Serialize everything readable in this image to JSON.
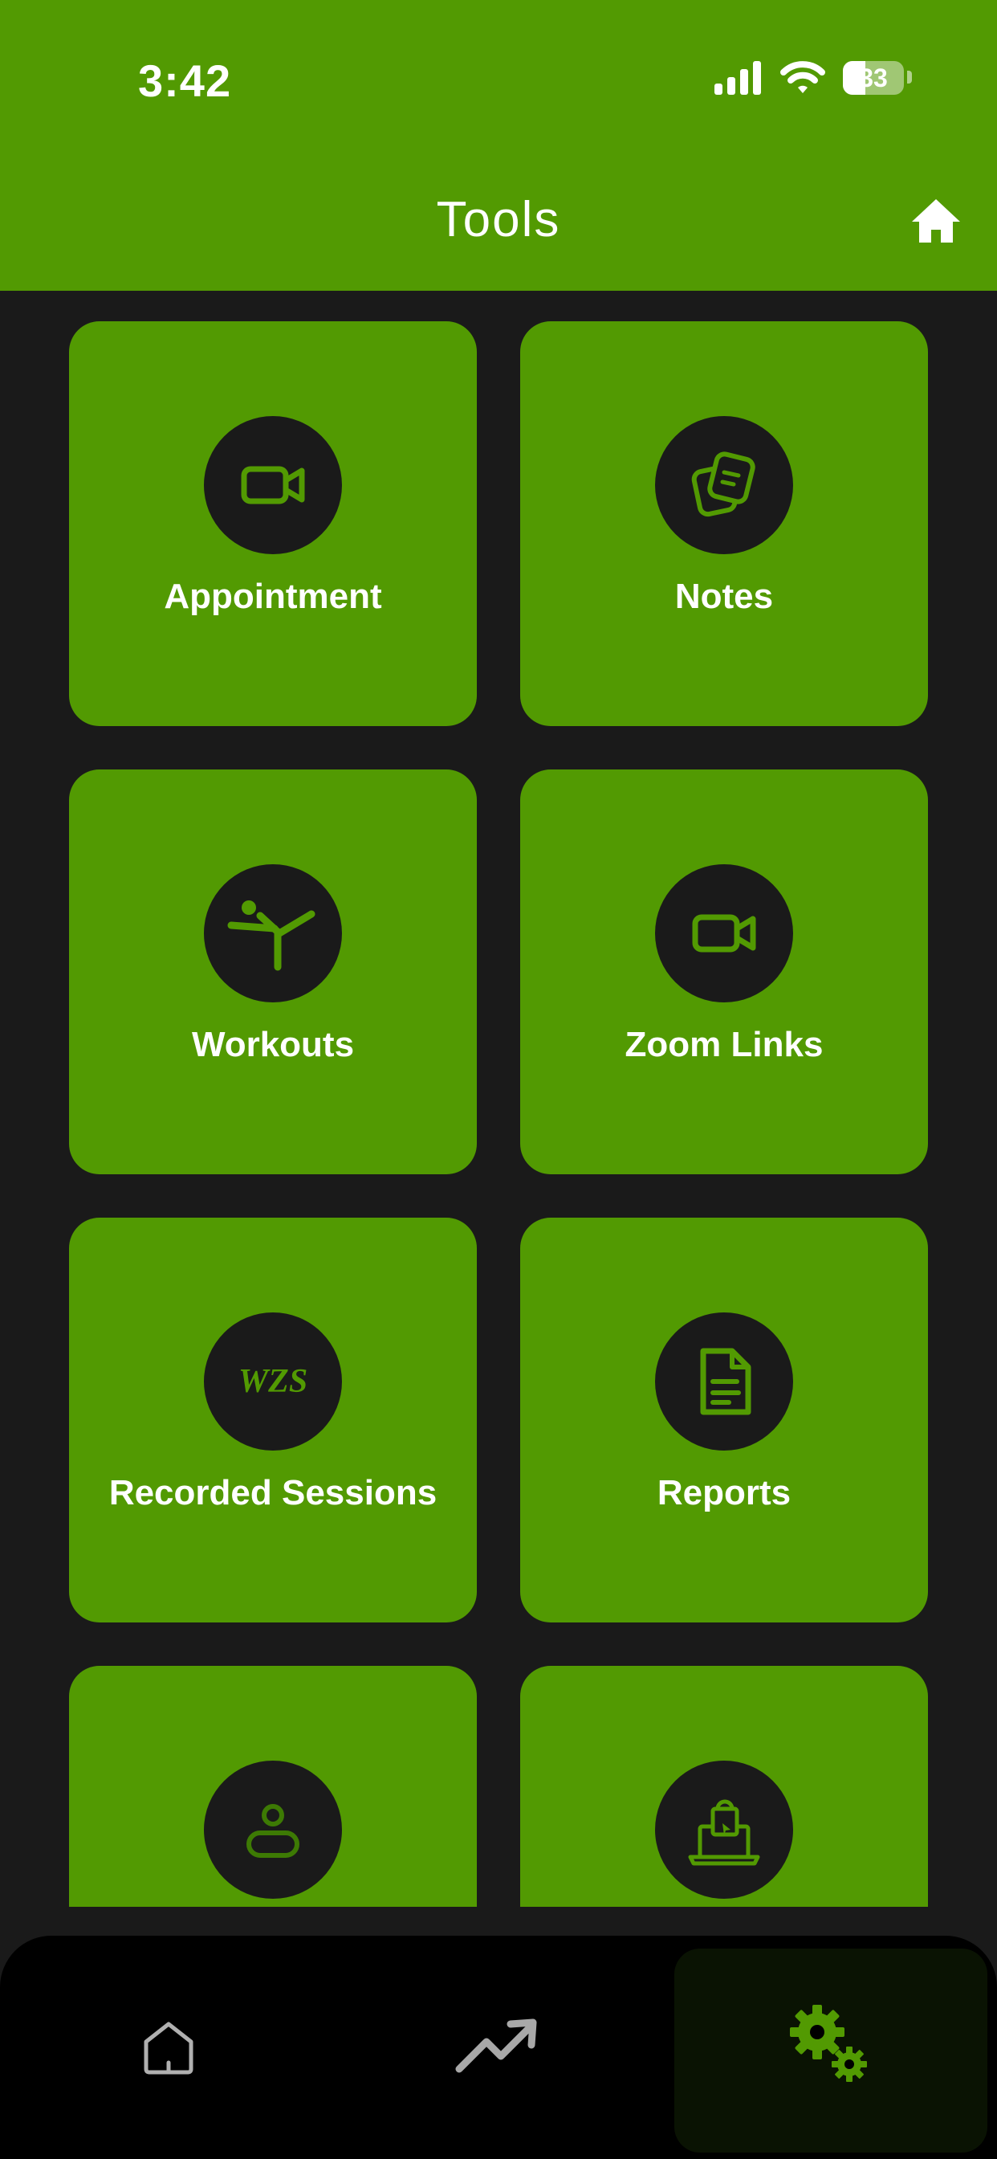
{
  "status_bar": {
    "time": "3:42",
    "battery": "33"
  },
  "header": {
    "title": "Tools",
    "home_icon": "home-icon"
  },
  "tiles": [
    {
      "label": "Appointment",
      "icon": "video-camera-icon"
    },
    {
      "label": "Notes",
      "icon": "notes-icon"
    },
    {
      "label": "Workouts",
      "icon": "martial-arts-kick-icon"
    },
    {
      "label": "Zoom Links",
      "icon": "video-camera-icon"
    },
    {
      "label": "Recorded Sessions",
      "icon": "wzs-logo",
      "logo_text": "WZS"
    },
    {
      "label": "Reports",
      "icon": "document-icon"
    },
    {
      "label": "",
      "icon": "person-icon"
    },
    {
      "label": "",
      "icon": "online-shop-icon"
    }
  ],
  "bottom_nav": [
    {
      "name": "home",
      "icon": "home-outline-icon"
    },
    {
      "name": "progress",
      "icon": "trending-up-icon"
    },
    {
      "name": "tools",
      "icon": "gears-icon",
      "active": true
    }
  ],
  "colors": {
    "accent": "#529a02",
    "background": "#1a1a1a",
    "nav_background": "#000000"
  }
}
